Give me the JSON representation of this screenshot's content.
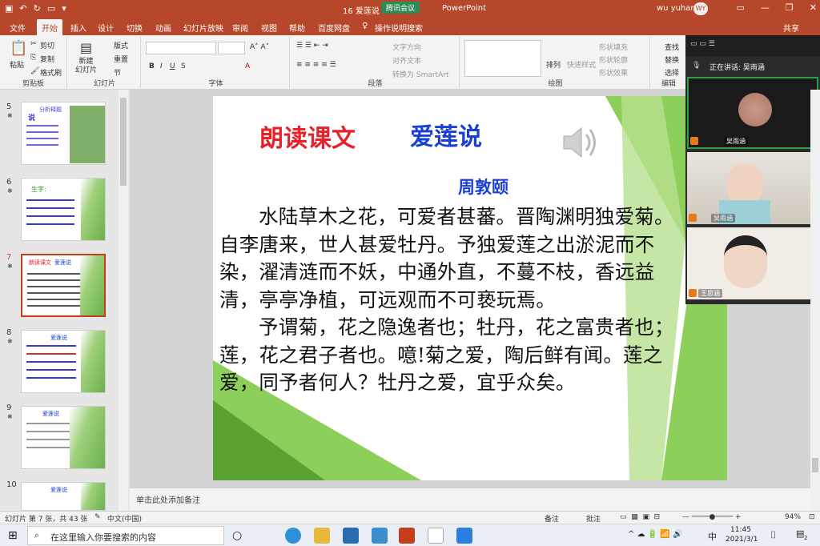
{
  "titlebar": {
    "doc_title": "16 爱莲说",
    "app_suffix": "PowerPoint",
    "meeting_badge": "腾讯会议",
    "user_name": "wu yuhan",
    "user_initials": "WY",
    "share": "共享"
  },
  "tabs": [
    "文件",
    "开始",
    "插入",
    "设计",
    "切换",
    "动画",
    "幻灯片放映",
    "审阅",
    "视图",
    "帮助",
    "百度网盘",
    "操作说明搜索"
  ],
  "active_tab": "开始",
  "ribbon": {
    "paste": "粘贴",
    "cut": "剪切",
    "copy": "复制",
    "format_painter": "格式刷",
    "clipboard_group": "剪贴板",
    "new_slide": "新建\n幻灯片",
    "layout": "版式",
    "reset": "重置",
    "section": "节",
    "slides_group": "幻灯片",
    "font_group": "字体",
    "text_direction": "文字方向",
    "align_text": "对齐文本",
    "smartart": "转换为 SmartArt",
    "paragraph_group": "段落",
    "arrange": "排列",
    "quick_styles": "快速样式",
    "shape_fill": "形状填充",
    "shape_outline": "形状轮廓",
    "shape_effects": "形状效果",
    "drawing_group": "绘图",
    "find": "查找",
    "replace": "替换",
    "select": "选择",
    "editing_group": "编辑"
  },
  "thumbnails": [
    {
      "num": "5",
      "title": "分析释题",
      "sub": "说"
    },
    {
      "num": "6",
      "title": "生字:"
    },
    {
      "num": "7",
      "title": "朗读课文",
      "sub": "爱莲说"
    },
    {
      "num": "8",
      "title": "爱莲说"
    },
    {
      "num": "9",
      "title": "爱莲说"
    },
    {
      "num": "10",
      "title": "爱莲说"
    }
  ],
  "slide": {
    "title_left": "朗读课文",
    "title_right": "爱莲说",
    "author": "周敦颐",
    "para1": "水陆草木之花，可爱者甚蕃。晋陶渊明独爱菊。自李唐来，世人甚爱牡丹。予独爱莲之出淤泥而不染，濯清涟而不妖，中通外直，不蔓不枝，香远益清，亭亭净植，可远观而不可亵玩焉。",
    "para2": "予谓菊，花之隐逸者也；牡丹，花之富贵者也；莲，花之君子者也。噫!菊之爱，陶后鲜有闻。莲之爱，同予者何人？牡丹之爱，宜乎众矣。"
  },
  "notes_placeholder": "单击此处添加备注",
  "status": {
    "slide_info": "幻灯片 第 7 张，共 43 张",
    "language": "中文(中国)",
    "notes": "备注",
    "comments": "批注",
    "zoom": "94%"
  },
  "meeting": {
    "speaking": "正在讲话: 吴雨涵",
    "p1": "吴雨涵",
    "p2": "吴雨涵",
    "p3": "王思涵"
  },
  "taskbar": {
    "search_placeholder": "在这里输入你要搜索的内容",
    "ime": "中",
    "time": "11:45",
    "date": "2021/3/1",
    "notif_count": "2"
  }
}
